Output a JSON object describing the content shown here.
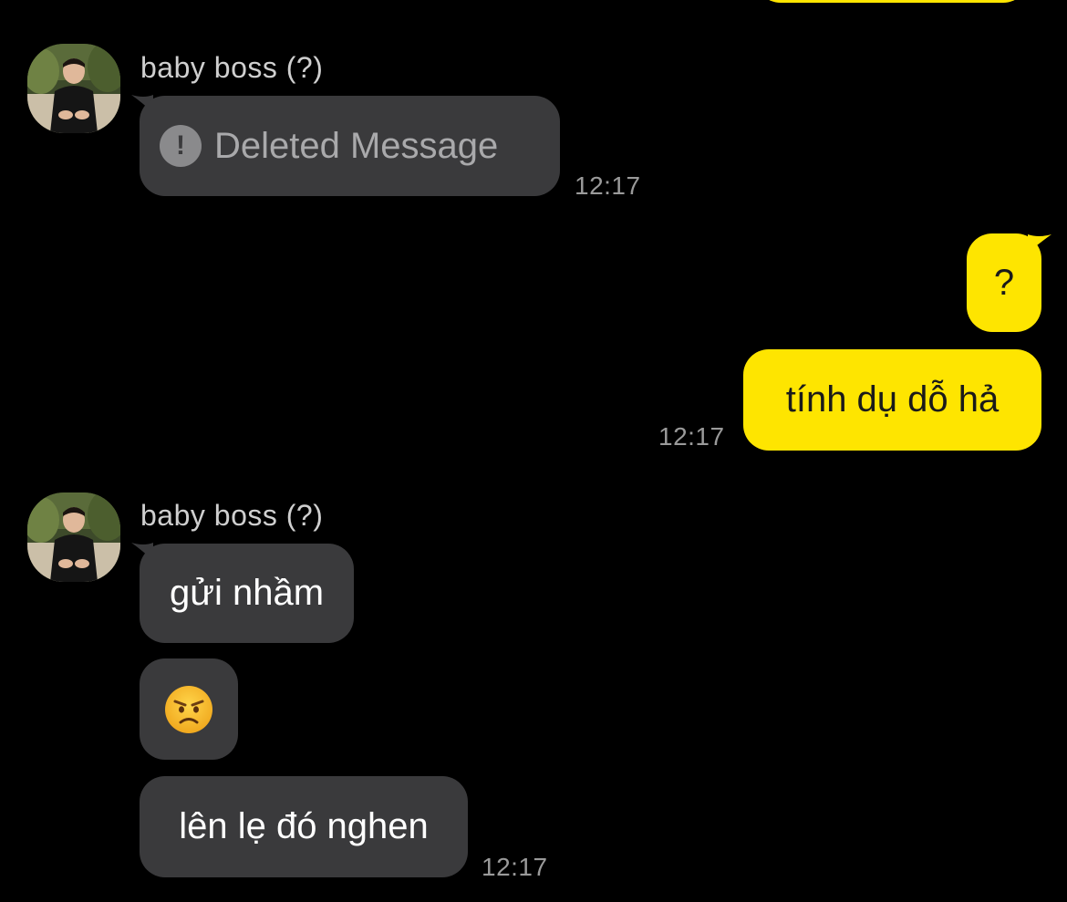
{
  "app": {
    "theme": {
      "background": "#000000",
      "incoming_bubble": "#3a3a3c",
      "outgoing_bubble": "#FEE500",
      "timestamp_color": "#9a9a9a"
    }
  },
  "messages": {
    "group1": {
      "sender": "baby boss (?)",
      "deleted_text": "Deleted Message",
      "deleted_icon": "exclamation-circle-icon",
      "time": "12:17"
    },
    "outgoing": {
      "msg1": "?",
      "msg2": "tính dụ dỗ hả",
      "time": "12:17"
    },
    "group2": {
      "sender": "baby boss (?)",
      "msg1": "gửi nhầm",
      "emoji": "angry-face-icon",
      "msg3": "lên lẹ đó nghen",
      "time": "12:17"
    }
  }
}
